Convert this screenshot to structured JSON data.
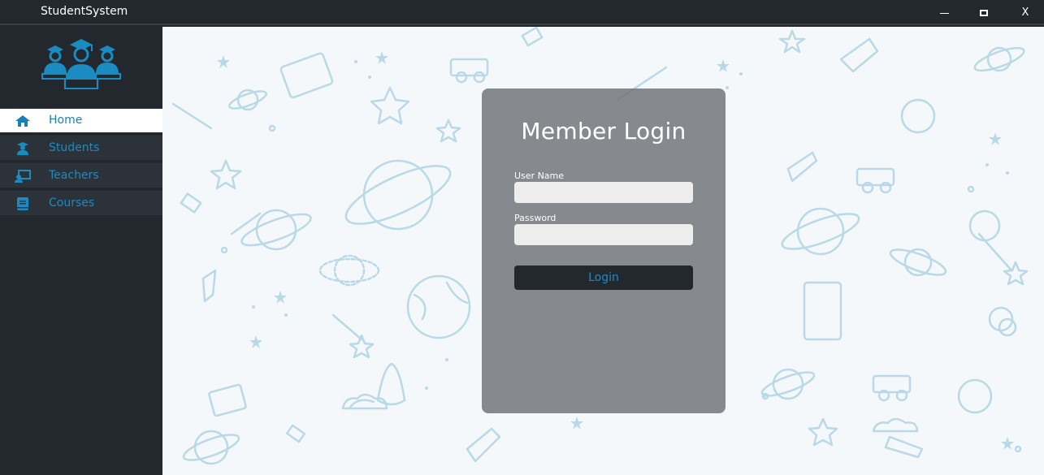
{
  "window": {
    "title": "StudentSystem",
    "close_label": "X"
  },
  "sidebar": {
    "items": [
      {
        "label": "Home",
        "icon": "home-icon",
        "active": true
      },
      {
        "label": "Students",
        "icon": "student-icon",
        "active": false
      },
      {
        "label": "Teachers",
        "icon": "teacher-icon",
        "active": false
      },
      {
        "label": "Courses",
        "icon": "book-icon",
        "active": false
      }
    ]
  },
  "login": {
    "title": "Member Login",
    "username_label": "User Name",
    "username_value": "",
    "password_label": "Password",
    "password_value": "",
    "button_label": "Login"
  },
  "colors": {
    "accent": "#1a8cc2",
    "dark": "#23282e",
    "doodle": "#b9d9e8"
  }
}
